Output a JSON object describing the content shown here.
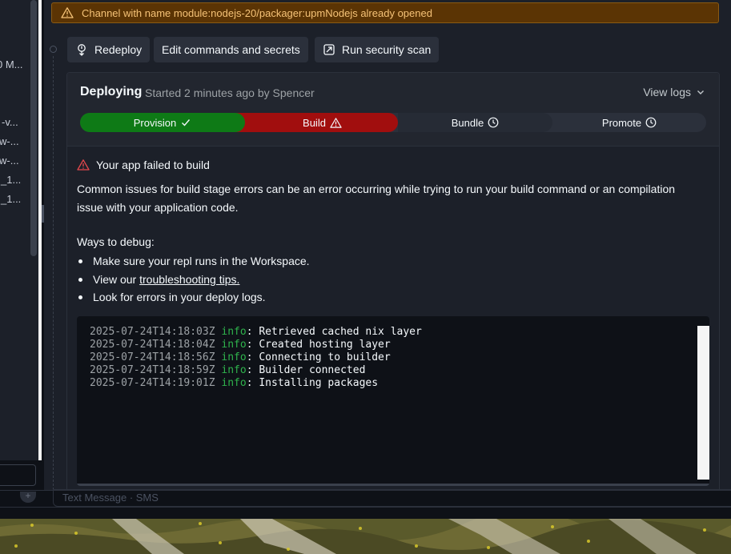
{
  "sidebar_fragments": [
    "0 M...",
    "-v...",
    "w-...",
    "w-...",
    "_1...",
    "_1..."
  ],
  "warning": {
    "icon": "warning-triangle-icon",
    "text": "Channel with name module:nodejs-20/packager:upmNodejs already opened"
  },
  "actions": {
    "redeploy": "Redeploy",
    "edit": "Edit commands and secrets",
    "scan": "Run security scan"
  },
  "deployment": {
    "title": "Deploying",
    "subtitle": "Started 2 minutes ago by Spencer",
    "view_logs": "View logs",
    "stages": [
      {
        "label": "Provision",
        "status": "success",
        "color": "#0e7a16"
      },
      {
        "label": "Build",
        "status": "failed",
        "color": "#a10e0e"
      },
      {
        "label": "Bundle",
        "status": "pending"
      },
      {
        "label": "Promote",
        "status": "pending"
      }
    ]
  },
  "error": {
    "title": "Your app failed to build",
    "description": "Common issues for build stage errors can be an error occurring while trying to run your build command or an compilation issue with your application code.",
    "ways_title": "Ways to debug:",
    "bullets": {
      "b1": "Make sure your repl runs in the Workspace.",
      "b2_prefix": "View our ",
      "b2_link": "troubleshooting tips.",
      "b3": "Look for errors in your deploy logs."
    }
  },
  "logs": [
    {
      "ts": "2025-07-24T14:18:03Z",
      "level": "info",
      "msg": ": Retrieved cached nix layer"
    },
    {
      "ts": "2025-07-24T14:18:04Z",
      "level": "info",
      "msg": ": Created hosting layer"
    },
    {
      "ts": "2025-07-24T14:18:56Z",
      "level": "info",
      "msg": ": Connecting to builder"
    },
    {
      "ts": "2025-07-24T14:18:59Z",
      "level": "info",
      "msg": ": Builder connected"
    },
    {
      "ts": "2025-07-24T14:19:01Z",
      "level": "info",
      "msg": ": Installing packages"
    }
  ],
  "bottom": {
    "placeholder": "Text Message · SMS"
  },
  "colors": {
    "success": "#0e7a16",
    "failure": "#a10e0e",
    "warning_bg": "#5b3404",
    "warning_text": "#f5c277",
    "log_info": "#2fb34c"
  }
}
